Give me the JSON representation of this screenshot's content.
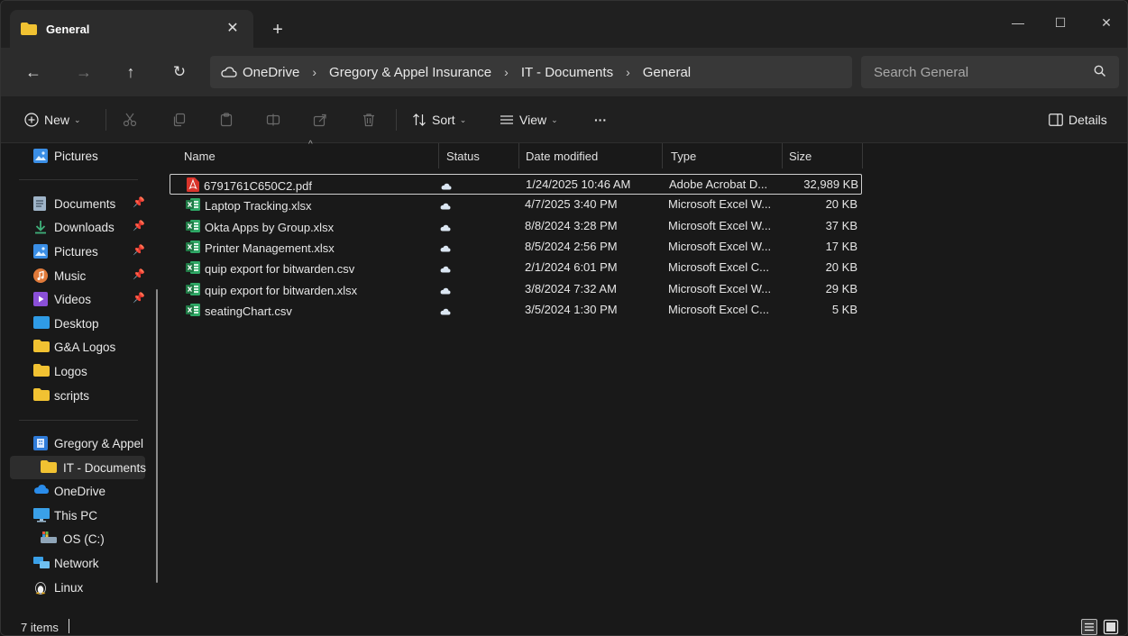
{
  "window": {
    "tab_title": "General",
    "tab_close": "✕",
    "new_tab": "+",
    "minimize": "—",
    "maximize": "☐",
    "close": "✕"
  },
  "navigation": {
    "back": "←",
    "forward": "→",
    "up": "↑",
    "refresh": "↻"
  },
  "breadcrumb": [
    "OneDrive",
    "Gregory & Appel Insurance",
    "IT - Documents",
    "General"
  ],
  "breadcrumb_separator": "›",
  "search": {
    "placeholder": "Search General"
  },
  "commands": {
    "new": "New",
    "sort": "Sort",
    "view": "View",
    "more": "···",
    "details": "Details"
  },
  "sidebar": {
    "top": [
      {
        "label": "Pictures",
        "icon": "pictures-icon"
      }
    ],
    "quick_access": [
      {
        "label": "Documents",
        "icon": "documents-icon",
        "pinned": true
      },
      {
        "label": "Downloads",
        "icon": "downloads-icon",
        "pinned": true
      },
      {
        "label": "Pictures",
        "icon": "pictures-icon",
        "pinned": true
      },
      {
        "label": "Music",
        "icon": "music-icon",
        "pinned": true
      },
      {
        "label": "Videos",
        "icon": "videos-icon",
        "pinned": true
      },
      {
        "label": "Desktop",
        "icon": "desktop-folder-icon"
      },
      {
        "label": "G&A Logos",
        "icon": "folder-icon"
      },
      {
        "label": "Logos",
        "icon": "folder-icon"
      },
      {
        "label": "scripts",
        "icon": "folder-icon"
      }
    ],
    "locations": [
      {
        "label": "Gregory & Appel",
        "icon": "sharepoint-icon"
      },
      {
        "label": "IT - Documents",
        "icon": "folder-icon",
        "selected": true
      },
      {
        "label": "OneDrive",
        "icon": "onedrive-icon"
      },
      {
        "label": "This PC",
        "icon": "this-pc-icon"
      },
      {
        "label": "OS (C:)",
        "icon": "drive-icon"
      },
      {
        "label": "Network",
        "icon": "network-icon"
      },
      {
        "label": "Linux",
        "icon": "linux-icon"
      }
    ]
  },
  "columns": [
    "Name",
    "Status",
    "Date modified",
    "Type",
    "Size"
  ],
  "sort_indicator": "^",
  "files": [
    {
      "name": "6791761C650C2.pdf",
      "icon": "pdf-icon",
      "status": "cloud",
      "date": "1/24/2025 10:46 AM",
      "type": "Adobe Acrobat D...",
      "size": "32,989 KB"
    },
    {
      "name": "Laptop Tracking.xlsx",
      "icon": "excel-icon",
      "status": "cloud",
      "date": "4/7/2025 3:40 PM",
      "type": "Microsoft Excel W...",
      "size": "20 KB"
    },
    {
      "name": "Okta Apps by Group.xlsx",
      "icon": "excel-icon",
      "status": "cloud",
      "date": "8/8/2024 3:28 PM",
      "type": "Microsoft Excel W...",
      "size": "37 KB"
    },
    {
      "name": "Printer Management.xlsx",
      "icon": "excel-icon",
      "status": "cloud",
      "date": "8/5/2024 2:56 PM",
      "type": "Microsoft Excel W...",
      "size": "17 KB"
    },
    {
      "name": "quip export for bitwarden.csv",
      "icon": "excel-icon",
      "status": "cloud",
      "date": "2/1/2024 6:01 PM",
      "type": "Microsoft Excel C...",
      "size": "20 KB"
    },
    {
      "name": "quip export for bitwarden.xlsx",
      "icon": "excel-icon",
      "status": "cloud",
      "date": "3/8/2024 7:32 AM",
      "type": "Microsoft Excel W...",
      "size": "29 KB"
    },
    {
      "name": "seatingChart.csv",
      "icon": "excel-icon",
      "status": "cloud",
      "date": "3/5/2024 1:30 PM",
      "type": "Microsoft Excel C...",
      "size": "5 KB"
    }
  ],
  "status_bar": {
    "item_count": "7 items"
  },
  "colors": {
    "folder": "#f1c232",
    "excel": "#1f8a4c",
    "pdf": "#d9342b",
    "cloud": "#4fa3ff",
    "background": "#191919"
  }
}
